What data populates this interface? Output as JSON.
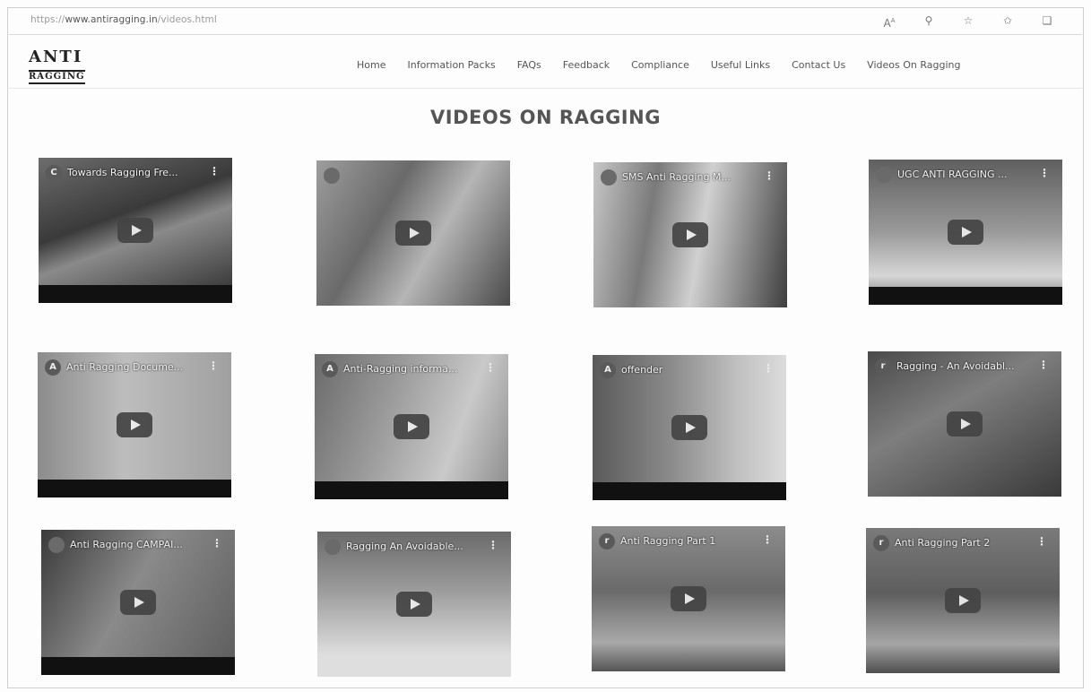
{
  "browser": {
    "url_prefix": "https://",
    "url_host": "www.antiragging.in",
    "url_path": "/videos.html",
    "icons": [
      "read-aloud-icon",
      "zoom-icon",
      "add-favorite-icon",
      "favorites-icon",
      "collections-icon"
    ]
  },
  "site": {
    "logo_line1": "ANTI",
    "logo_line2": "RAGGING",
    "nav": [
      "Home",
      "Information Packs",
      "FAQs",
      "Feedback",
      "Compliance",
      "Useful Links",
      "Contact Us",
      "Videos On Ragging"
    ],
    "page_title": "VIDEOS ON RAGGING"
  },
  "videos": [
    {
      "channel": "C",
      "title": "Towards Ragging Fre..."
    },
    {
      "channel": "",
      "title": ""
    },
    {
      "channel": "",
      "title": "SMS Anti Ragging M..."
    },
    {
      "channel": "",
      "title": "UGC ANTI RAGGING ..."
    },
    {
      "channel": "A",
      "title": "Anti Ragging Docume..."
    },
    {
      "channel": "A",
      "title": "Anti-Ragging informa..."
    },
    {
      "channel": "A",
      "title": "offender"
    },
    {
      "channel": "r",
      "title": "Ragging - An Avoidabl..."
    },
    {
      "channel": "",
      "title": "Anti Ragging CAMPAI..."
    },
    {
      "channel": "",
      "title": "Ragging An Avoidable..."
    },
    {
      "channel": "r",
      "title": "Anti Ragging Part 1"
    },
    {
      "channel": "r",
      "title": "Anti Ragging Part 2"
    }
  ]
}
